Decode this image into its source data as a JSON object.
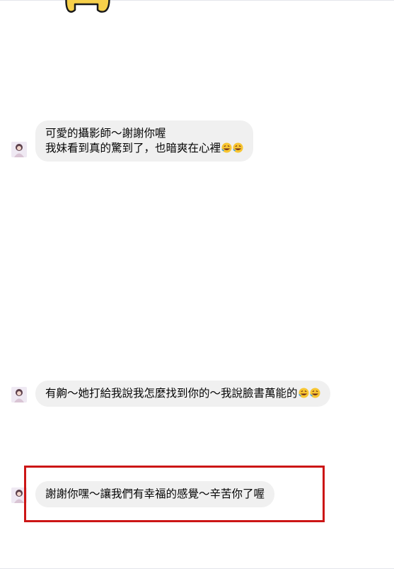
{
  "conversation": {
    "messages": [
      {
        "lines": [
          "可愛的攝影師～謝謝你喔",
          "我妹看到真的驚到了，也暗爽在心裡"
        ],
        "emoji_after_last_line": [
          "rofl-emoji",
          "rofl-emoji"
        ]
      },
      {
        "lines": [
          "有齁～她打給我說我怎麼找到你的～我說臉書萬能的"
        ],
        "emoji_after_last_line": [
          "rofl-emoji",
          "rofl-emoji"
        ]
      },
      {
        "lines": [
          "謝謝你嘿～讓我們有幸福的感覺～辛苦你了喔"
        ],
        "emoji_after_last_line": [],
        "highlighted": true
      }
    ]
  },
  "colors": {
    "bubble_background": "#f0f0f0",
    "highlight_border": "#cc1616",
    "sticker_yellow": "#f7d04a"
  }
}
